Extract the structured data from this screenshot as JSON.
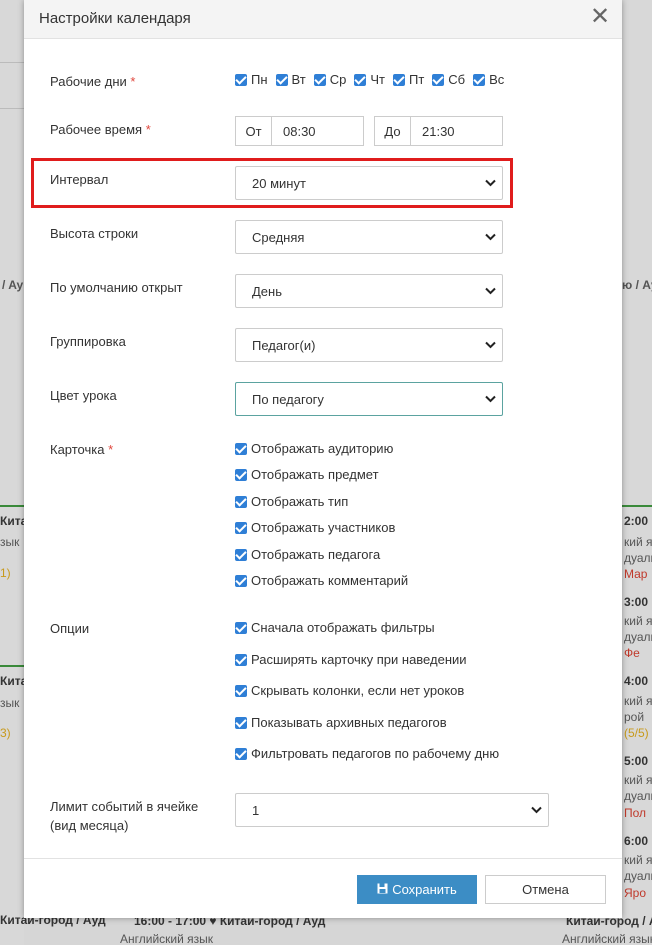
{
  "dialog": {
    "title": "Настройки календаря",
    "close_glyph": "✕"
  },
  "work_days": {
    "label": "Рабочие дни",
    "required_mark": "*",
    "days": [
      "Пн",
      "Вт",
      "Ср",
      "Чт",
      "Пт",
      "Сб",
      "Вс"
    ],
    "checked": [
      true,
      true,
      true,
      true,
      true,
      true,
      true
    ]
  },
  "work_time": {
    "label": "Рабочее время",
    "required_mark": "*",
    "from_label": "От",
    "from_value": "08:30",
    "to_label": "До",
    "to_value": "21:30"
  },
  "interval": {
    "label": "Интервал",
    "value": "20 минут"
  },
  "row_height": {
    "label": "Высота строки",
    "value": "Средняя"
  },
  "default_open": {
    "label": "По умолчанию открыт",
    "value": "День"
  },
  "grouping": {
    "label": "Группировка",
    "value": "Педагог(и)"
  },
  "lesson_color": {
    "label": "Цвет урока",
    "value": "По педагогу"
  },
  "card": {
    "label": "Карточка",
    "required_mark": "*",
    "options": [
      "Отображать аудиторию",
      "Отображать предмет",
      "Отображать тип",
      "Отображать участников",
      "Отображать педагога",
      "Отображать комментарий"
    ]
  },
  "options": {
    "label": "Опции",
    "items": [
      "Сначала отображать фильтры",
      "Расширять карточку при наведении",
      "Скрывать колонки, если нет уроков",
      "Показывать архивных педагогов",
      "Фильтровать педагогов по рабочему дню"
    ]
  },
  "event_limit": {
    "label_line1": "Лимит событий в ячейке",
    "label_line2": "(вид месяца)",
    "value": "1"
  },
  "buttons": {
    "save": "Сохранить",
    "cancel": "Отмена"
  },
  "background": {
    "left": [
      {
        "text": "/ Ay"
      },
      {
        "text": "Кита"
      },
      {
        "text": "зык"
      },
      {
        "text": "1)"
      },
      {
        "text": "Кита"
      },
      {
        "text": "зык"
      },
      {
        "text": "3)"
      },
      {
        "text": "Китай-город / Ауд"
      }
    ],
    "right": [
      {
        "text": "ю / Ау"
      },
      {
        "text": "2:00"
      },
      {
        "text": "кий я"
      },
      {
        "text": "дуаль"
      },
      {
        "text": "Мар"
      },
      {
        "text": "3:00"
      },
      {
        "text": "кий я"
      },
      {
        "text": "дуаль"
      },
      {
        "text": "Фе"
      },
      {
        "text": "4:00"
      },
      {
        "text": "кий я"
      },
      {
        "text": "рой"
      },
      {
        "text": "(5/5)"
      },
      {
        "text": "5:00"
      },
      {
        "text": "кий я"
      },
      {
        "text": "дуаль"
      },
      {
        "text": "Пол"
      },
      {
        "text": "6:00"
      },
      {
        "text": "кий я"
      },
      {
        "text": "дуаль"
      },
      {
        "text": "Яро"
      }
    ],
    "bottom": [
      {
        "text": "16:00 - 17:00 ♥ Китай-город / Ауд"
      },
      {
        "text": "Английский язык"
      },
      {
        "text": "Китай-город / Ауд"
      },
      {
        "text": "Английский язык"
      }
    ]
  }
}
